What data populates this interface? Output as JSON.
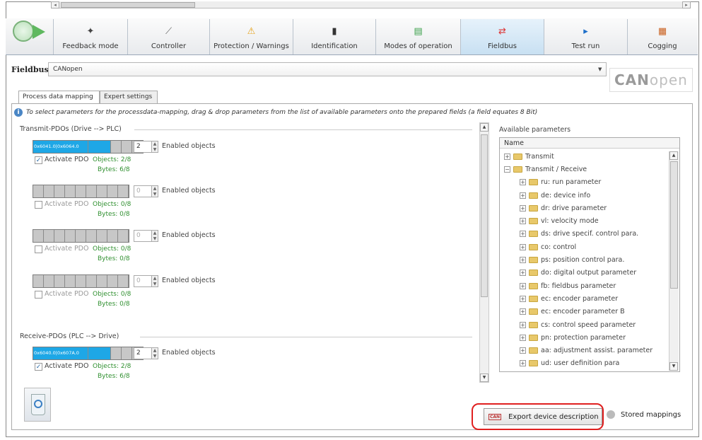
{
  "toolbar": {
    "tabs": [
      {
        "label": "Feedback mode",
        "icon": "feedback-icon"
      },
      {
        "label": "Controller",
        "icon": "controller-icon"
      },
      {
        "label": "Protection / Warnings",
        "icon": "warning-icon"
      },
      {
        "label": "Identification",
        "icon": "identification-icon"
      },
      {
        "label": "Modes of operation",
        "icon": "modes-icon"
      },
      {
        "label": "Fieldbus",
        "icon": "fieldbus-icon",
        "active": true
      },
      {
        "label": "Test run",
        "icon": "play-icon"
      },
      {
        "label": "Cogging",
        "icon": "cogging-icon"
      }
    ]
  },
  "fieldbus": {
    "label": "Fieldbus:",
    "selected": "CANopen",
    "logo_main": "CAN",
    "logo_sub": "open"
  },
  "subtabs": [
    "Process data mapping",
    "Expert settings"
  ],
  "info_text": "To select parameters for the processdata-mapping, drag & drop parameters from the list of available parameters onto the prepared fields (a field equates 8 Bit)",
  "transmit": {
    "title": "Transmit-PDOs (Drive --> PLC)",
    "pdos": [
      {
        "cells": [
          "0x6041.0",
          "0x6064.0"
        ],
        "count": "2",
        "enabled_label": "Enabled objects",
        "activate_label": "Activate PDO",
        "checked": true,
        "objects": "Objects: 2/8",
        "bytes": "Bytes: 6/8"
      },
      {
        "cells": [],
        "count": "0",
        "enabled_label": "Enabled objects",
        "activate_label": "Activate PDO",
        "checked": false,
        "objects": "Objects: 0/8",
        "bytes": "Bytes: 0/8"
      },
      {
        "cells": [],
        "count": "0",
        "enabled_label": "Enabled objects",
        "activate_label": "Activate PDO",
        "checked": false,
        "objects": "Objects: 0/8",
        "bytes": "Bytes: 0/8"
      },
      {
        "cells": [],
        "count": "0",
        "enabled_label": "Enabled objects",
        "activate_label": "Activate PDO",
        "checked": false,
        "objects": "Objects: 0/8",
        "bytes": "Bytes: 0/8"
      }
    ]
  },
  "receive": {
    "title": "Receive-PDOs (PLC --> Drive)",
    "pdos": [
      {
        "cells": [
          "0x6040.0",
          "0x607A.0"
        ],
        "count": "2",
        "enabled_label": "Enabled objects",
        "activate_label": "Activate PDO",
        "checked": true,
        "objects": "Objects: 2/8",
        "bytes": "Bytes: 6/8"
      }
    ]
  },
  "available": {
    "title": "Available parameters",
    "column": "Name",
    "items": [
      {
        "label": "Transmit",
        "level": 0,
        "expanded": false
      },
      {
        "label": "Transmit / Receive",
        "level": 0,
        "expanded": true
      },
      {
        "label": "ru: run parameter",
        "level": 1
      },
      {
        "label": "de: device info",
        "level": 1
      },
      {
        "label": "dr: drive parameter",
        "level": 1
      },
      {
        "label": "vl: velocity mode",
        "level": 1
      },
      {
        "label": "ds: drive specif. control para.",
        "level": 1
      },
      {
        "label": "co: control",
        "level": 1
      },
      {
        "label": "ps: position control para.",
        "level": 1
      },
      {
        "label": "do: digital output parameter",
        "level": 1
      },
      {
        "label": "fb: fieldbus parameter",
        "level": 1
      },
      {
        "label": "ec: encoder parameter",
        "level": 1
      },
      {
        "label": "ec: encoder parameter B",
        "level": 1
      },
      {
        "label": "cs: control speed parameter",
        "level": 1
      },
      {
        "label": "pn: protection parameter",
        "level": 1
      },
      {
        "label": "aa: adjustment assist. parameter",
        "level": 1
      },
      {
        "label": "ud: user definition para",
        "level": 1
      }
    ]
  },
  "buttons": {
    "export": "Export device description",
    "export_icon_text": "CAN",
    "stored": "Stored mappings"
  },
  "colors": {
    "cell_on": "#1ea7e6",
    "highlight": "#e02020",
    "ok_text": "#2f8f2f"
  }
}
